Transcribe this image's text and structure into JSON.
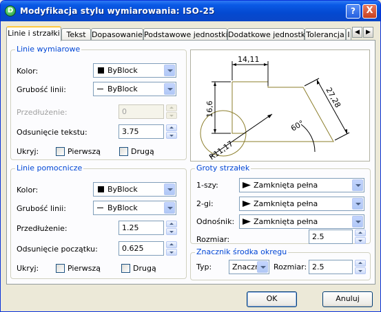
{
  "window": {
    "title": "Modyfikacja stylu wymiarowania: ISO-25",
    "icon_label": "D"
  },
  "titlebar_buttons": {
    "help": "?",
    "close": "X"
  },
  "tabs": [
    "Linie i strzałki",
    "Tekst",
    "Dopasowanie",
    "Podstawowe jednostki",
    "Dodatkowe jednostki",
    "Tolerancja",
    "I"
  ],
  "linie_wymiarowe": {
    "title": "Linie wymiarowe",
    "kolor_label": "Kolor:",
    "kolor_value": "ByBlock",
    "grubosc_label": "Grubość linii:",
    "grubosc_value": "ByBlock",
    "przedluzenie_label": "Przedłużenie:",
    "przedluzenie_value": "0",
    "odsuniecie_label": "Odsunięcie tekstu:",
    "odsuniecie_value": "3.75",
    "ukryj_label": "Ukryj:",
    "pierwsza": "Pierwszą",
    "druga": "Drugą"
  },
  "linie_pomocnicze": {
    "title": "Linie pomocnicze",
    "kolor_label": "Kolor:",
    "kolor_value": "ByBlock",
    "grubosc_label": "Grubość linii:",
    "grubosc_value": "ByBlock",
    "przedluzenie_label": "Przedłużenie:",
    "przedluzenie_value": "1.25",
    "odsuniecie_label": "Odsunięcie początku:",
    "odsuniecie_value": "0.625",
    "ukryj_label": "Ukryj:",
    "pierwsza": "Pierwszą",
    "druga": "Drugą"
  },
  "preview": {
    "dim_top": "14,11",
    "dim_left": "16,6",
    "dim_right": "27,28",
    "dim_angle": "60°",
    "dim_radius": "R11,17"
  },
  "groty": {
    "title": "Groty strzałek",
    "first_label": "1-szy:",
    "first_value": "Zamknięta pełna",
    "second_label": "2-gi:",
    "second_value": "Zamknięta pełna",
    "odnosnik_label": "Odnośnik:",
    "odnosnik_value": "Zamknięta pełna",
    "rozmiar_label": "Rozmiar:",
    "rozmiar_value": "2.5"
  },
  "znacznik": {
    "title": "Znacznik środka okregu",
    "typ_label": "Typ:",
    "typ_value": "Znaczn",
    "rozmiar_label": "Rozmiar:",
    "rozmiar_value": "2.5"
  },
  "buttons": {
    "ok": "OK",
    "cancel": "Anuluj"
  }
}
